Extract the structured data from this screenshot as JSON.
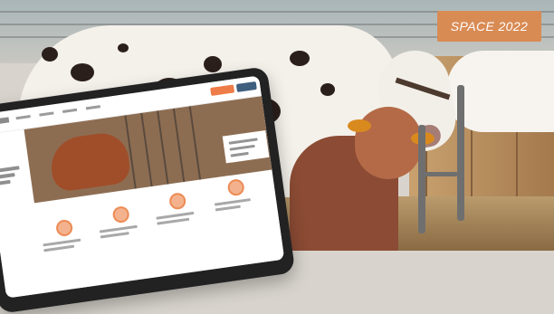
{
  "badge": {
    "text": "SPACE 2022"
  },
  "scene": {
    "accent": "#d98b54",
    "icons": [
      "cow-body",
      "calf",
      "stall",
      "tablet"
    ]
  },
  "tablet": {
    "brand_accent": "#ee7c48",
    "secondary_accent": "#3f5f7f",
    "icons": [
      "logo-mark",
      "cow-photo",
      "feature-icon"
    ]
  }
}
